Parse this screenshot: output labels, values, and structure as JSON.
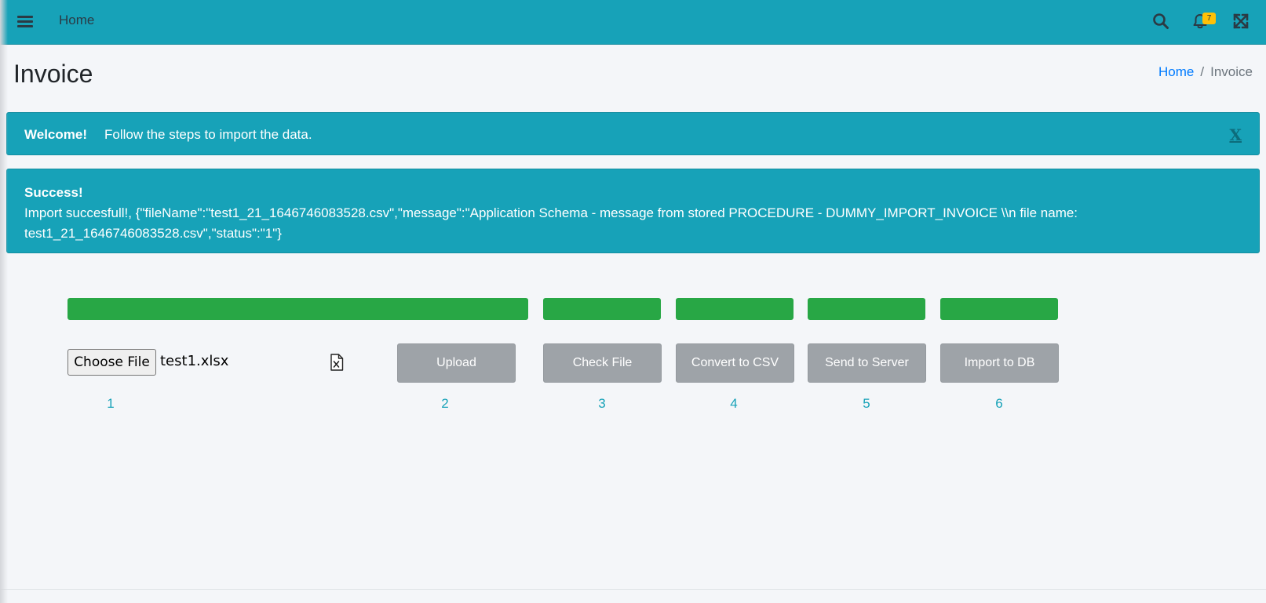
{
  "navbar": {
    "menu_icon": "hamburger-icon",
    "home_label": "Home",
    "search_icon": "search-icon",
    "bell_icon": "bell-icon",
    "notification_count": "7",
    "expand_icon": "expand-icon"
  },
  "page": {
    "title": "Invoice",
    "breadcrumb": {
      "home": "Home",
      "separator": "/",
      "current": "Invoice"
    }
  },
  "alerts": {
    "welcome": {
      "strong": "Welcome!",
      "message": "Follow the steps to import the data.",
      "close": "X"
    },
    "success": {
      "strong": "Success!",
      "message": "Import succesfull!, {\"fileName\":\"test1_21_1646746083528.csv\",\"message\":\"Application Schema - message from stored PROCEDURE - DUMMY_IMPORT_INVOICE \\\\n file name: test1_21_1646746083528.csv\",\"status\":\"1\"}"
    }
  },
  "progress_bars": [
    {
      "label": "step-1-2",
      "progress": 1.0
    },
    {
      "label": "step-3",
      "progress": 1.0
    },
    {
      "label": "step-4",
      "progress": 1.0
    },
    {
      "label": "step-5",
      "progress": 1.0
    },
    {
      "label": "step-6",
      "progress": 1.0
    }
  ],
  "file_input": {
    "button_label": "Choose File",
    "file_name": "test1.xlsx",
    "icon": "excel-file-icon"
  },
  "steps": {
    "upload": "Upload",
    "check_file": "Check File",
    "convert_csv": "Convert to CSV",
    "send_server": "Send to Server",
    "import_db": "Import to DB"
  },
  "step_numbers": [
    "1",
    "2",
    "3",
    "4",
    "5",
    "6"
  ],
  "colors": {
    "navbar": "#17a2b8",
    "alert": "#17a2b8",
    "progress": "#28a745",
    "step_button": "#9ea3a8",
    "step_number": "#17a2b8",
    "link": "#007bff",
    "badge": "#ffc107"
  }
}
